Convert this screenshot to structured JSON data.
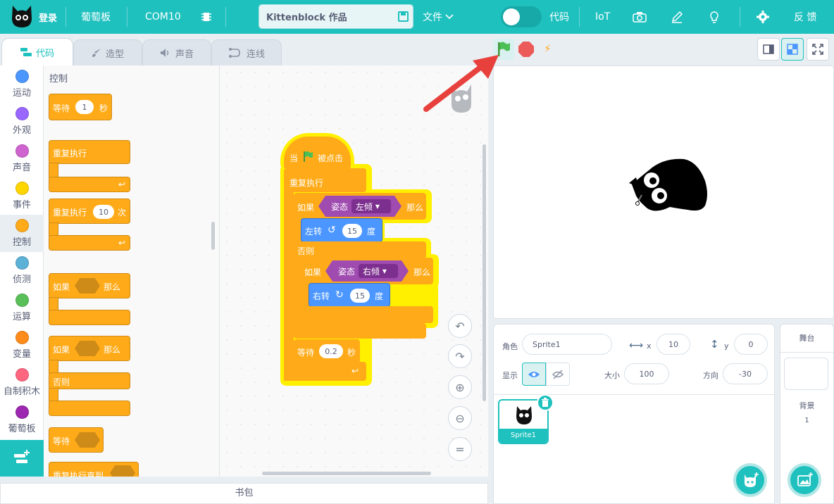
{
  "header": {
    "login": "登录",
    "board": "葡萄板",
    "port": "COM10",
    "project_title": "Kittenblock 作品",
    "file_menu": "文件",
    "code_toggle": "代码",
    "iot": "IoT",
    "feedback": "反 馈"
  },
  "tabs": [
    {
      "label": "代码"
    },
    {
      "label": "造型"
    },
    {
      "label": "声音"
    },
    {
      "label": "连线"
    }
  ],
  "categories": [
    {
      "label": "运动",
      "color": "#4c97ff"
    },
    {
      "label": "外观",
      "color": "#9966ff"
    },
    {
      "label": "声音",
      "color": "#cf63cf"
    },
    {
      "label": "事件",
      "color": "#ffd500"
    },
    {
      "label": "控制",
      "color": "#ffab19"
    },
    {
      "label": "侦测",
      "color": "#5cb1d6"
    },
    {
      "label": "运算",
      "color": "#59c059"
    },
    {
      "label": "变量",
      "color": "#ff8c1a"
    },
    {
      "label": "自制积木",
      "color": "#ff6680"
    },
    {
      "label": "葡萄板",
      "color": "#9c27b0"
    }
  ],
  "palette": {
    "heading": "控制",
    "wait_label": "等待",
    "wait_value": "1",
    "wait_unit": "秒",
    "forever": "重复执行",
    "repeat": "重复执行",
    "repeat_value": "10",
    "repeat_unit": "次",
    "if": "如果",
    "then": "那么",
    "if2": "如果",
    "then2": "那么",
    "else": "否则",
    "wait_until": "等待",
    "repeat_until": "重复执行直到"
  },
  "script": {
    "hat_when": "当",
    "hat_clicked": "被点击",
    "forever": "重复执行",
    "if1": "如果",
    "attitude1": "姿态",
    "left_tilt": "左倾",
    "then1": "那么",
    "turn_left": "左转",
    "turn_left_value": "15",
    "deg1": "度",
    "else": "否则",
    "if2": "如果",
    "attitude2": "姿态",
    "right_tilt": "右倾",
    "then2": "那么",
    "turn_right": "右转",
    "turn_right_value": "15",
    "deg2": "度",
    "wait": "等待",
    "wait_value": "0.2",
    "wait_unit": "秒"
  },
  "zoom_buttons": {
    "reset": "="
  },
  "backpack": "书包",
  "sprite_info": {
    "sprite_label": "角色",
    "sprite_name": "Sprite1",
    "x_label": "x",
    "x_value": "10",
    "y_label": "y",
    "y_value": "0",
    "show_label": "显示",
    "size_label": "大小",
    "size_value": "100",
    "direction_label": "方向",
    "direction_value": "-30"
  },
  "sprite_tile": {
    "name": "Sprite1"
  },
  "stage_panel": {
    "title": "舞台",
    "backdrop_label": "背景",
    "backdrop_count": "1"
  },
  "colors": {
    "header_bg": "#1fc1bf",
    "control": "#ffab19",
    "motion": "#4c97ff",
    "sensor": "#9f4bb0",
    "highlight": "#fff000",
    "stop": "#ec5959",
    "flag": "#4cbf56",
    "arrow": "#e8403c"
  }
}
